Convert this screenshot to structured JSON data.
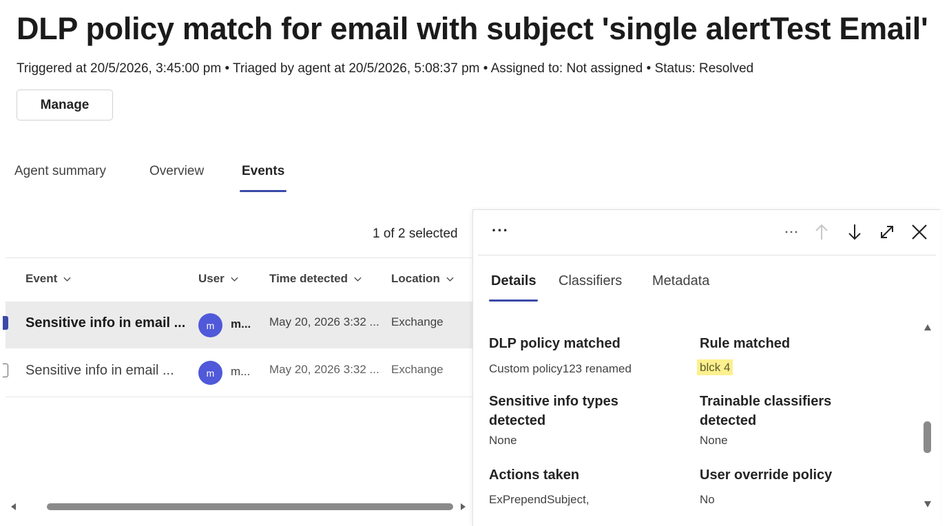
{
  "header": {
    "title": "DLP policy match for email with subject 'single alertTest Email'",
    "meta": "Triggered at 20/5/2026, 3:45:00 pm • Triaged by agent at 20/5/2026, 5:08:37 pm • Assigned to: Not assigned • Status: Resolved",
    "manage_label": "Manage"
  },
  "tabs": [
    {
      "label": "Agent summary",
      "active": false
    },
    {
      "label": "Overview",
      "active": false
    },
    {
      "label": "Events",
      "active": true
    }
  ],
  "events": {
    "selected_count": "1 of 2 selected",
    "columns": [
      "Event",
      "User",
      "Time detected",
      "Location"
    ],
    "rows": [
      {
        "event": "Sensitive info in email ...",
        "avatar": "m",
        "user": "m...",
        "time": "May 20, 2026 3:32 ...",
        "location": "Exchange",
        "selected": true
      },
      {
        "event": "Sensitive info in email ...",
        "avatar": "m",
        "user": "m...",
        "time": "May 20, 2026 3:32 ...",
        "location": "Exchange",
        "selected": false
      }
    ]
  },
  "panel": {
    "more_label": "···",
    "tabs": [
      {
        "label": "Details",
        "active": true
      },
      {
        "label": "Classifiers",
        "active": false
      },
      {
        "label": "Metadata",
        "active": false
      }
    ],
    "fields": {
      "dlp_policy_label": "DLP policy matched",
      "dlp_policy_value": "Custom policy123 renamed",
      "rule_label": "Rule matched",
      "rule_value": "blck 4",
      "sit_label_1": "Sensitive info types",
      "sit_label_2": "detected",
      "sit_value": "None",
      "tc_label_1": "Trainable classifiers",
      "tc_label_2": "detected",
      "tc_value": "None",
      "actions_label": "Actions taken",
      "actions_value": "ExPrependSubject,",
      "override_label": "User override policy",
      "override_value": "No"
    }
  },
  "colors": {
    "accent": "#3b4aa8",
    "avatar": "#4f59d9",
    "highlight": "#fcf08f",
    "selected_row": "#ebebeb"
  }
}
